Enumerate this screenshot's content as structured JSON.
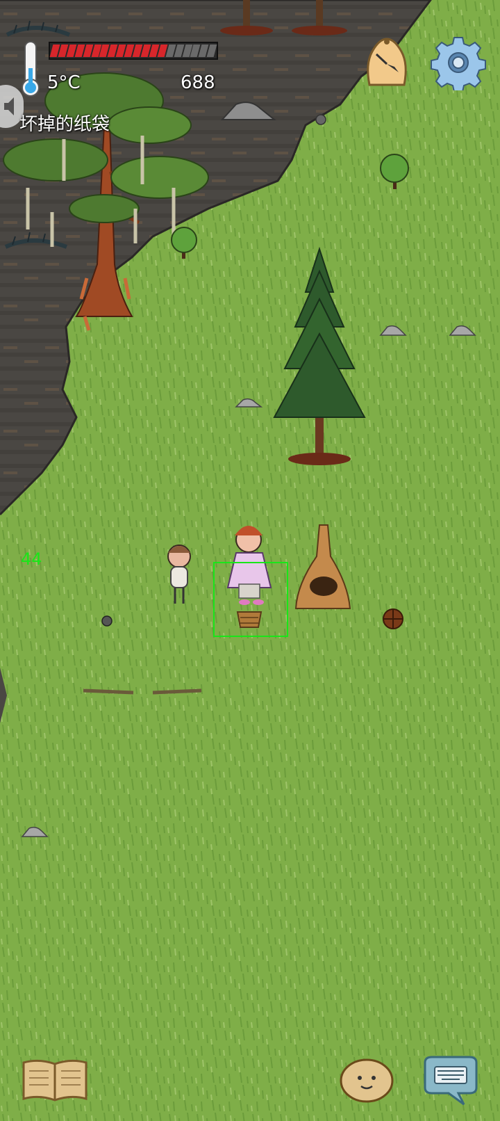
{
  "hud": {
    "temperature": "5°C",
    "yum_counter": "688",
    "hovered_object": "坏掉的纸袋",
    "age": "44",
    "food_meter": {
      "filled": 14,
      "total": 20
    }
  },
  "colors": {
    "grass": "#7fae48",
    "swamp": "#4a4743",
    "food_fill": "#d7262b",
    "food_empty": "#6a6a6a",
    "selection": "#19e619",
    "age_text": "#19e619"
  },
  "icons": {
    "thermometer": "thermometer-icon",
    "clock": "clock-icon",
    "settings": "gear-icon",
    "speaker": "speaker-icon",
    "tech_tree": "book-icon",
    "emote": "face-icon",
    "chat": "keyboard-chat-icon"
  }
}
